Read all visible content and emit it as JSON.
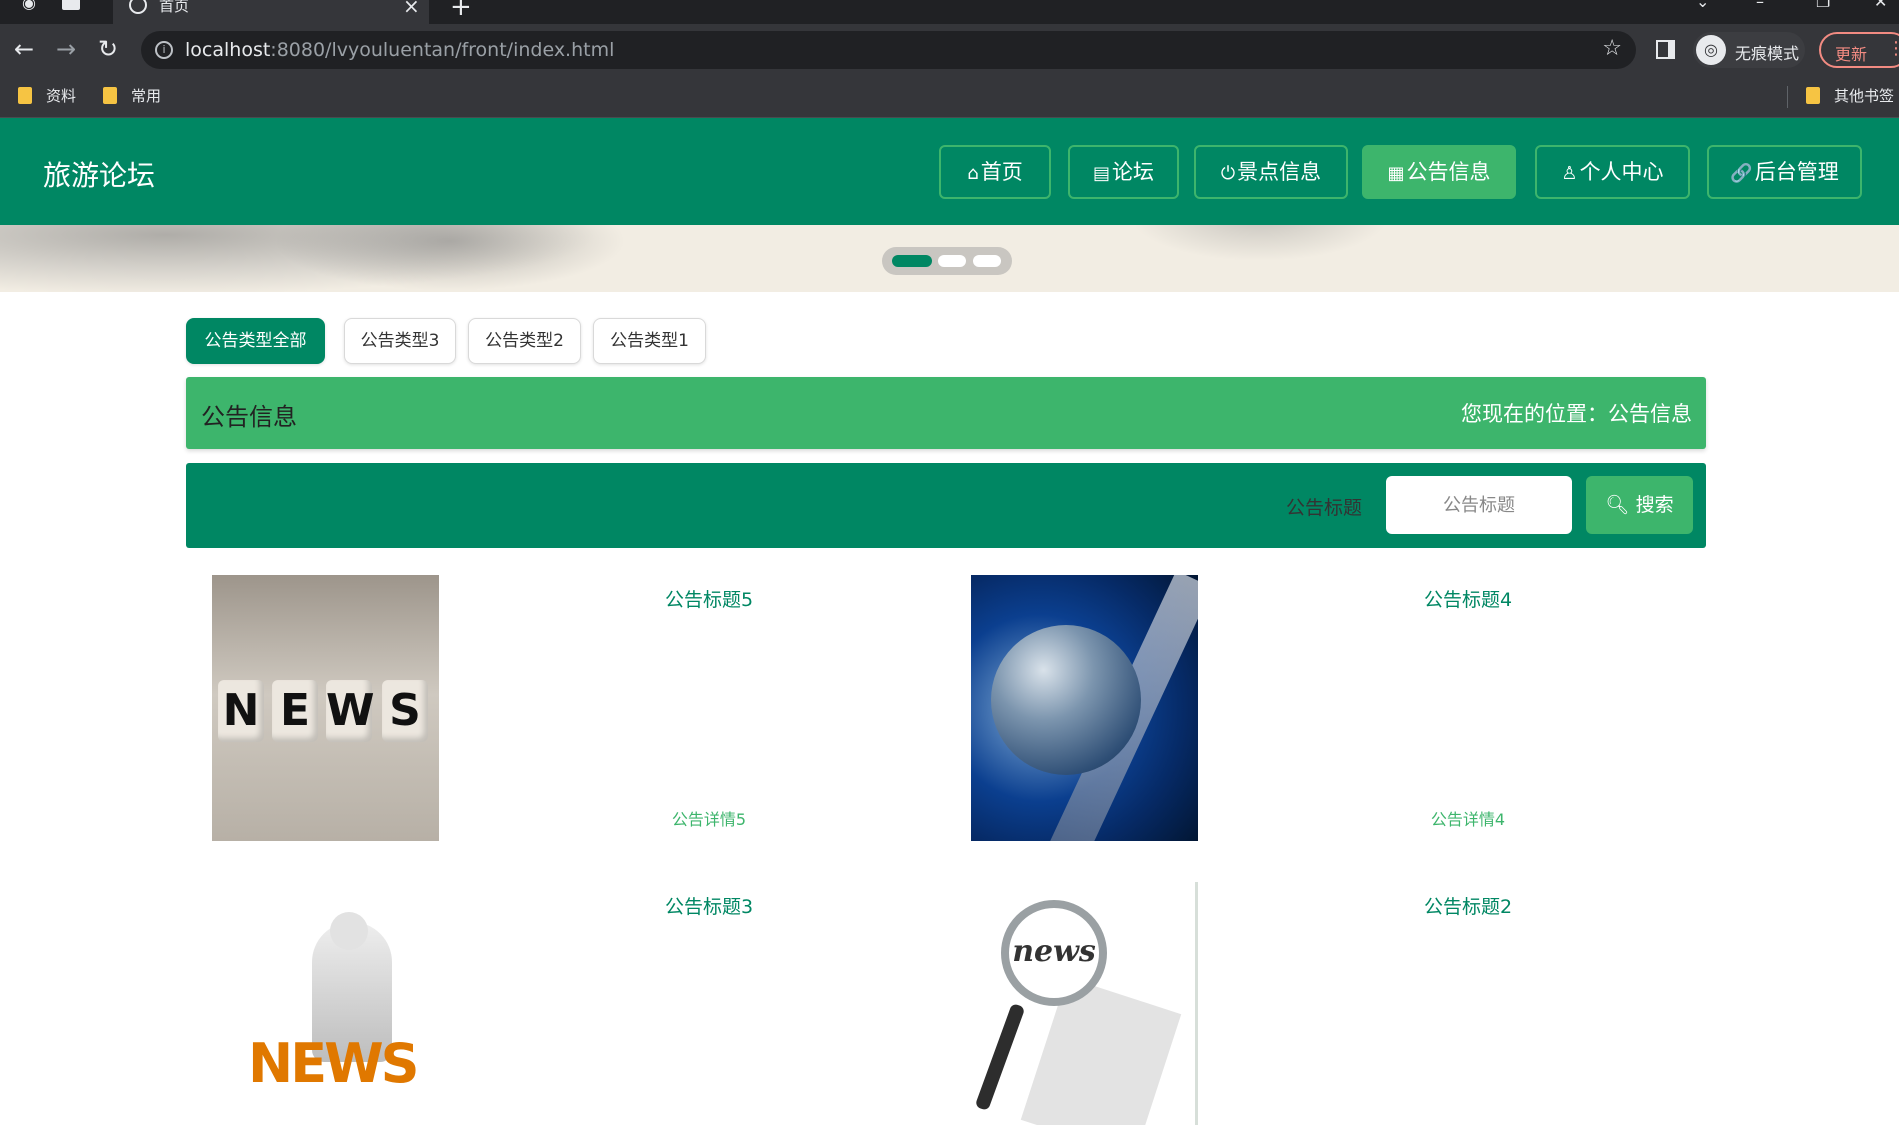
{
  "browser": {
    "active_tab_title": "首页",
    "url_host": "localhost",
    "url_rest": ":8080/lvyouluentan/front/index.html",
    "incognito_label": "无痕模式",
    "update_label": "更新",
    "bookmarks": [
      "资料",
      "常用"
    ],
    "other_bookmarks": "其他书签"
  },
  "site": {
    "brand": "旅游论坛",
    "nav": [
      {
        "icon": "home-icon",
        "label": "首页"
      },
      {
        "icon": "forum-icon",
        "label": "论坛"
      },
      {
        "icon": "spot-icon",
        "label": "景点信息"
      },
      {
        "icon": "notice-icon",
        "label": "公告信息"
      },
      {
        "icon": "user-icon",
        "label": "个人中心"
      },
      {
        "icon": "link-icon",
        "label": "后台管理"
      }
    ],
    "active_nav": "公告信息",
    "theme_color": "#008763",
    "accent_color": "#3db56c"
  },
  "type_tabs": [
    "公告类型全部",
    "公告类型3",
    "公告类型2",
    "公告类型1"
  ],
  "active_type_tab": "公告类型全部",
  "section": {
    "title": "公告信息",
    "location": "您现在的位置：公告信息"
  },
  "search": {
    "label": "公告标题",
    "placeholder": "公告标题",
    "button": "搜索"
  },
  "notices": [
    {
      "title": "公告标题5",
      "detail": "公告详情5",
      "image": "news-cubes-image"
    },
    {
      "title": "公告标题4",
      "detail": "公告详情4",
      "image": "globe-image"
    },
    {
      "title": "公告标题3",
      "image": "reading-man-image"
    },
    {
      "title": "公告标题2",
      "image": "magnifier-image"
    }
  ],
  "image_text": {
    "news_cubes": [
      "N",
      "E",
      "W",
      "S"
    ],
    "reading_man": "NEWS",
    "magnifier": "news"
  }
}
